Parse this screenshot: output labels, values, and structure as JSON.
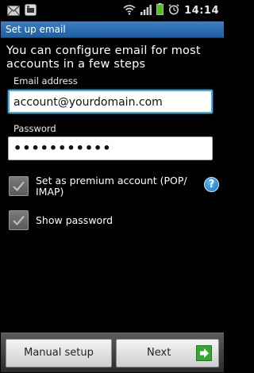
{
  "status_bar": {
    "time": "14:14",
    "icons": [
      "email-icon",
      "bbm-icon",
      "wifi-icon",
      "signal-icon",
      "battery-icon",
      "alarm-icon"
    ],
    "battery_color": "#4fc11b"
  },
  "title_bar": {
    "title": "Set up email",
    "color": "#2d6fb4"
  },
  "intro_text": "You can configure email for most accounts in a few steps",
  "form": {
    "email_label": "Email address",
    "email_value": "account@yourdomain.com",
    "password_label": "Password",
    "password_value": "•••••••••••"
  },
  "options": {
    "premium_label": "Set as premium account (POP/ IMAP)",
    "premium_checked": true,
    "show_password_label": "Show password",
    "show_password_checked": true,
    "help_symbol": "?"
  },
  "buttons": {
    "manual_setup": "Manual setup",
    "next": "Next"
  },
  "colors": {
    "accent": "#4aa8e0",
    "next_arrow": "#36a832"
  }
}
